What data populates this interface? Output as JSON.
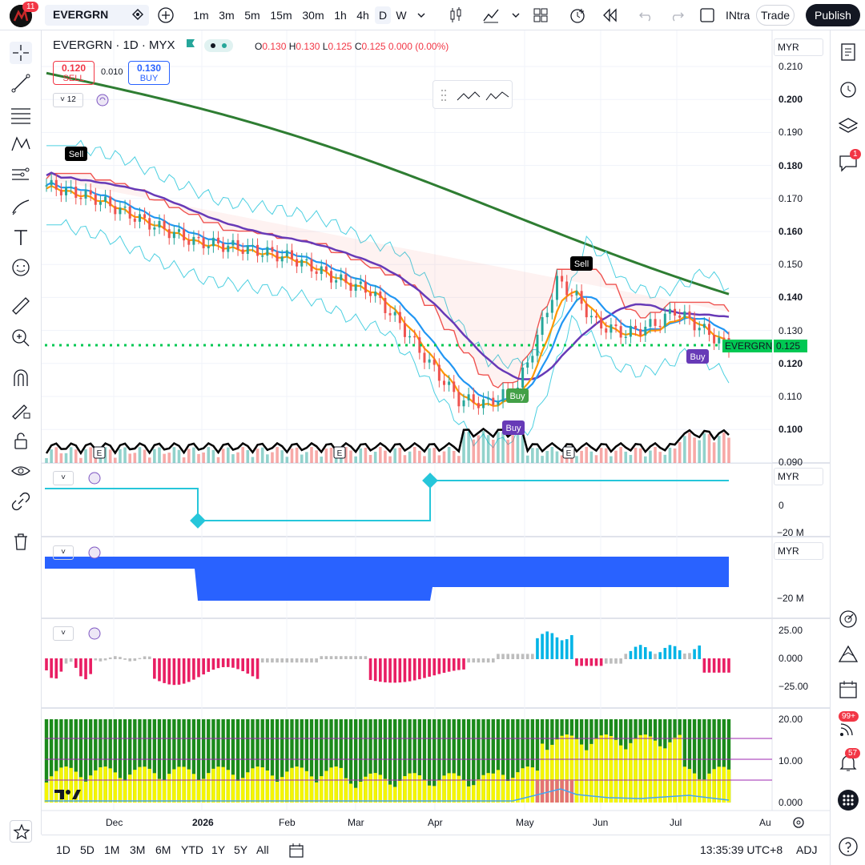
{
  "topbar": {
    "logo_badge": "11",
    "symbol": "EVERGRN",
    "intervals": [
      "1m",
      "3m",
      "5m",
      "15m",
      "30m",
      "1h",
      "4h",
      "D",
      "W"
    ],
    "active_interval": "D",
    "indicator_label": "INtra",
    "trade_label": "Trade",
    "publish_label": "Publish"
  },
  "legend": {
    "title": "EVERGRN · 1D · MYX",
    "ohlc": {
      "o": "0.130",
      "h": "0.130",
      "l": "0.125",
      "c": "0.125",
      "chg": "0.000 (0.00%)"
    },
    "o_label": "O",
    "h_label": "H",
    "l_label": "L",
    "c_label": "C",
    "sell_price": "0.120",
    "sell_label": "SELL",
    "buy_price": "0.130",
    "buy_label": "BUY",
    "spread": "0.010",
    "collapse_count": "12"
  },
  "price_axis": {
    "currency": "MYR",
    "ticks": [
      "0.210",
      "0.200",
      "0.190",
      "0.180",
      "0.170",
      "0.160",
      "0.150",
      "0.140",
      "0.130",
      "0.120",
      "0.110",
      "0.100",
      "0.090"
    ],
    "last_label": "EVERGRN",
    "last_price": "0.125"
  },
  "pane2": {
    "currency": "MYR",
    "ticks": [
      "0",
      "−20 M"
    ]
  },
  "pane3": {
    "currency": "MYR",
    "ticks": [
      "−20 M"
    ]
  },
  "pane4": {
    "ticks": [
      "25.00",
      "0.000",
      "−25.00"
    ]
  },
  "pane5": {
    "ticks": [
      "20.00",
      "10.00",
      "0.000"
    ]
  },
  "time_axis": [
    "Dec",
    "2026",
    "Feb",
    "Mar",
    "Apr",
    "May",
    "Jun",
    "Jul",
    "Au"
  ],
  "signals": {
    "sell": "Sell",
    "buy": "Buy",
    "earnings": "E"
  },
  "bottombar": {
    "ranges": [
      "1D",
      "5D",
      "1M",
      "3M",
      "6M",
      "YTD",
      "1Y",
      "5Y",
      "All"
    ],
    "clock": "13:35:39 UTC+8",
    "adj": "ADJ"
  },
  "righttools": {
    "chat_badge": "1",
    "stream_badge": "99+",
    "alerts_badge": "57"
  },
  "colors": {
    "up": "#26a69a",
    "down": "#ef5350",
    "ma_long": "#2e7d32",
    "ma_mid": "#673ab7",
    "ma_fast": "#2196f3",
    "ma_faster": "#ff9800",
    "accent": "#2962ff",
    "last_price": "#00c853"
  }
}
